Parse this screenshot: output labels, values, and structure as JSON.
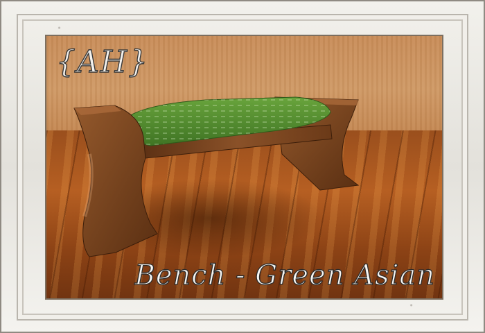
{
  "brand": {
    "logo_text": "{AH}"
  },
  "product": {
    "caption": "Bench - Green Asian"
  },
  "colors": {
    "frame": "#eeece7",
    "wall": "#cb925e",
    "floor": "#a4541e",
    "wood": "#7a4522",
    "cushion": "#4f8a2e"
  }
}
